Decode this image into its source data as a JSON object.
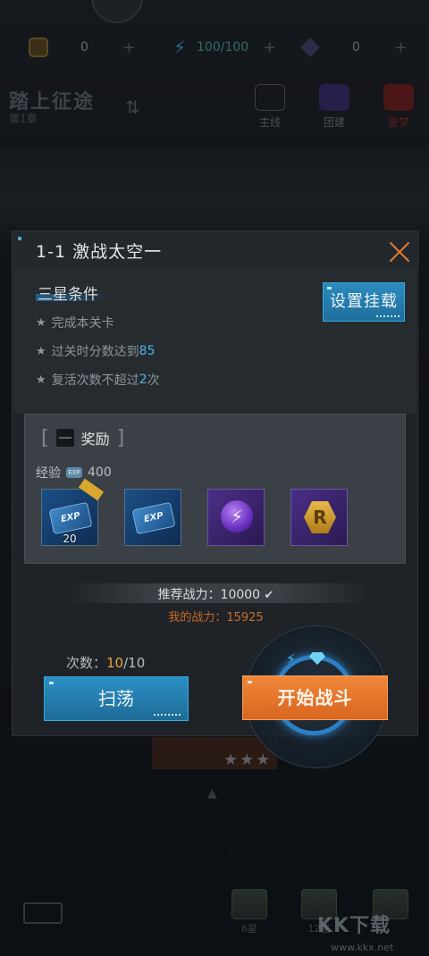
{
  "top_bar": {
    "resources": [
      {
        "icon": "badge-coin-icon",
        "value": "0",
        "plus": "+"
      },
      {
        "icon": "lightning-energy-icon",
        "value": "100/100",
        "plus": "+"
      },
      {
        "icon": "crystal-gem-icon",
        "value": "0",
        "plus": "+"
      }
    ]
  },
  "background": {
    "title": "踏上征途",
    "chapter": "第1章",
    "modes": [
      {
        "label": "主线"
      },
      {
        "label": "团建"
      },
      {
        "label": "噩梦"
      }
    ],
    "nav": [
      {
        "label": "6星"
      },
      {
        "label": "12星"
      },
      {
        "label": ""
      }
    ],
    "stars": "★★★"
  },
  "watermark": {
    "text": "KK下载",
    "url": "www.kkx.net"
  },
  "modal": {
    "title": "1-1  激战太空一",
    "conditions_title": "三星条件",
    "conditions": [
      {
        "prefix": "完成本关卡",
        "highlight": "",
        "suffix": ""
      },
      {
        "prefix": "过关时分数达到",
        "highlight": "85",
        "suffix": ""
      },
      {
        "prefix": "复活次数不超过",
        "highlight": "2",
        "suffix": "次"
      }
    ],
    "hang_button": "设置挂载",
    "rewards_title": "奖励",
    "exp_label": "经验",
    "exp_badge": "EXP",
    "exp_value": "400",
    "reward_items": [
      {
        "type": "exp-card",
        "label": "EXP",
        "qty": "20"
      },
      {
        "type": "exp-card",
        "label": "EXP",
        "qty": ""
      },
      {
        "type": "energy-orb",
        "label": "⚡",
        "qty": ""
      },
      {
        "type": "r-badge",
        "label": "R",
        "qty": ""
      }
    ],
    "recommended_power": "推荐战力：10000",
    "my_power": "我的战力：15925",
    "times_label": "次数：",
    "times_current": "10",
    "times_total": "/10",
    "sweep_button": "扫荡",
    "start_button": "开始战斗"
  }
}
